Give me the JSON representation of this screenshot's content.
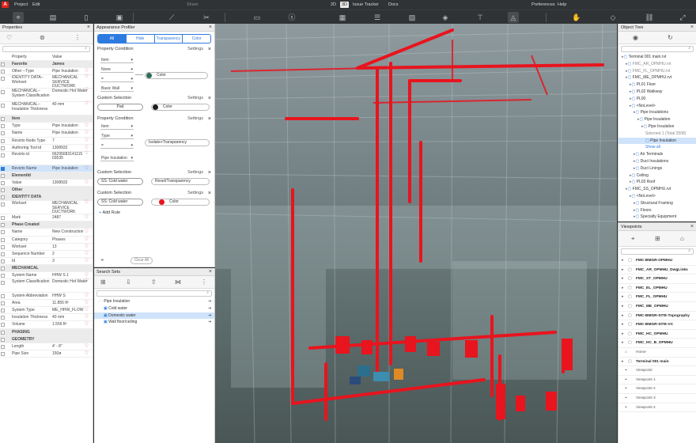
{
  "app": {
    "logo": "A"
  },
  "menu": {
    "project": "Project",
    "edit": "Edit",
    "share": "Share",
    "view2d": "2D",
    "view3d": "3D",
    "issue": "Issue Tracker",
    "docs": "Docs",
    "prefs": "Preferences",
    "help": "Help"
  },
  "props": {
    "title": "Properties",
    "col_prop": "Property",
    "col_val": "Value",
    "rows": [
      {
        "t": "g",
        "n": "Favorite",
        "v": "James"
      },
      {
        "t": "r",
        "n": "Other --Type",
        "v": "Pipe Insulation",
        "h": 1
      },
      {
        "t": "t",
        "n": "IDENTITY DATA--Workset",
        "v": "MECHANICAL SERVICE DUCTWORK",
        "h": 1
      },
      {
        "t": "t",
        "n": "MECHANICAL--System Classification",
        "v": "Domestic Hot Water",
        "h": 1
      },
      {
        "t": "t",
        "n": "MECHANICAL--Insulation Thickness",
        "v": "40 mm",
        "h": 1
      },
      {
        "t": "g",
        "n": "Item",
        "v": ""
      },
      {
        "t": "r",
        "n": "Type",
        "v": "Pipe Insulation",
        "h": 1
      },
      {
        "t": "r",
        "n": "Name",
        "v": "Pipe Insulation",
        "h": 1
      },
      {
        "t": "r",
        "n": "Revizto Node Type",
        "v": "7",
        "h": 1
      },
      {
        "t": "r",
        "n": "Authoring Tool id",
        "v": "1308932",
        "h": 1
      },
      {
        "t": "t",
        "n": "Revizto id",
        "v": "66295683141115 03535",
        "h": 1
      },
      {
        "t": "s",
        "n": "Revizto Name",
        "v": "Pipe Insulation",
        "h": 1
      },
      {
        "t": "g",
        "n": "ElementId",
        "v": ""
      },
      {
        "t": "r",
        "n": "Value",
        "v": "1308932",
        "h": 1
      },
      {
        "t": "g",
        "n": "Other",
        "v": ""
      },
      {
        "t": "g",
        "n": "IDENTITY DATA",
        "v": ""
      },
      {
        "t": "t",
        "n": "Workset",
        "v": "MECHANICAL SERVICE DUCTWORK",
        "h": 1
      },
      {
        "t": "r",
        "n": "Mark",
        "v": "2487",
        "h": 1
      },
      {
        "t": "g",
        "n": "Phase Created",
        "v": ""
      },
      {
        "t": "r",
        "n": "Name",
        "v": "New Construction",
        "h": 1
      },
      {
        "t": "r",
        "n": "Category",
        "v": "Phases",
        "h": 1
      },
      {
        "t": "r",
        "n": "Workset",
        "v": "13",
        "h": 1
      },
      {
        "t": "r",
        "n": "Sequence Number",
        "v": "2",
        "h": 1
      },
      {
        "t": "r",
        "n": "Id",
        "v": "3",
        "h": 1
      },
      {
        "t": "g",
        "n": "MECHANICAL",
        "v": ""
      },
      {
        "t": "r",
        "n": "System Name",
        "v": "HHW S 1",
        "h": 1
      },
      {
        "t": "t",
        "n": "System Classification",
        "v": "Domestic Hot Water",
        "h": 1
      },
      {
        "t": "r",
        "n": "System Abbreviation",
        "v": "HHW S",
        "h": 1
      },
      {
        "t": "r",
        "n": "Area",
        "v": "11.855 ft²",
        "h": 1
      },
      {
        "t": "r",
        "n": "System Type",
        "v": "ME_HHW_FLOW",
        "h": 1
      },
      {
        "t": "r",
        "n": "Insulation Thickness",
        "v": "40 mm",
        "h": 1
      },
      {
        "t": "r",
        "n": "Volume",
        "v": "1.556 ft³",
        "h": 1
      },
      {
        "t": "g",
        "n": "PHASING",
        "v": ""
      },
      {
        "t": "g",
        "n": "GEOMETRY",
        "v": ""
      },
      {
        "t": "r",
        "n": "Length",
        "v": "4' - 8\"",
        "h": 1
      },
      {
        "t": "r",
        "n": "Pipe Size",
        "v": "150ø",
        "h": 1
      }
    ]
  },
  "appearance": {
    "title": "Appearance Profiler",
    "tabs": [
      "All",
      "Hide",
      "Transparency",
      "Color"
    ],
    "settings": "Settings",
    "prop_cond": "Property Condition",
    "custom_sel": "Custom Selection",
    "dd": {
      "item": "Item",
      "none": "None",
      "eq": "=",
      "basic": "Basic Wall",
      "type": "Type",
      "isolate": "Isolate+Transparency",
      "pipeins": "Pipe Insulation",
      "reset": "Reset/Transparency"
    },
    "color": "Color",
    "pad": "Pad",
    "ss_cold": "SS: Cold water",
    "add_rule": "Add Rule",
    "clear_all": "Clear All"
  },
  "search": {
    "title": "Search Sets",
    "items": [
      "Pipe Insulation",
      "Cold water",
      "Domestic water",
      "Wall floor/ceiling"
    ]
  },
  "tree": {
    "title": "Object Tree",
    "rows": [
      {
        "d": 0,
        "t": "Terminal 001 main.rvt"
      },
      {
        "d": 1,
        "t": "FMC_AR_OPMHU.rvt",
        "g": 1
      },
      {
        "d": 1,
        "t": "FMC_FL_OPMHU.rvt",
        "g": 1
      },
      {
        "d": 1,
        "t": "FMC_ME_OPMHU.rvt"
      },
      {
        "d": 2,
        "t": "PL01 Floor"
      },
      {
        "d": 2,
        "t": "PL02 Walkway"
      },
      {
        "d": 2,
        "t": "PL00"
      },
      {
        "d": 2,
        "t": "<NoLevel>"
      },
      {
        "d": 3,
        "t": "Pipe Insulations"
      },
      {
        "d": 4,
        "t": "Pipe Insulation"
      },
      {
        "d": 5,
        "t": "Pipe Insulation"
      },
      {
        "d": 6,
        "t": "Selected 1 (Total 2508)",
        "g": 1
      },
      {
        "d": 6,
        "t": "Pipe Insulation",
        "hl": 1
      },
      {
        "d": 6,
        "t": "Show all",
        "l": 1
      },
      {
        "d": 3,
        "t": "Air Terminals"
      },
      {
        "d": 3,
        "t": "Duct Insulations"
      },
      {
        "d": 3,
        "t": "Duct Linings"
      },
      {
        "d": 2,
        "t": "Ceiling"
      },
      {
        "d": 2,
        "t": "PL03 Roof"
      },
      {
        "d": 1,
        "t": "FMC_SS_OPMHU.rvt"
      },
      {
        "d": 2,
        "t": "<NoLevel>"
      },
      {
        "d": 3,
        "t": "Structural Framing"
      },
      {
        "d": 3,
        "t": "Floors"
      },
      {
        "d": 3,
        "t": "Specialty Equipment"
      }
    ]
  },
  "viewpoints": {
    "title": "Viewpoints",
    "rows": [
      {
        "t": "FMC-BMGR-OPMHU",
        "b": 1
      },
      {
        "t": "FMC_AR_OPMHU_DwgLinks",
        "b": 1
      },
      {
        "t": "FMC_ST_OPMHU",
        "b": 1
      },
      {
        "t": "FMC_EL_OPMHU",
        "b": 1
      },
      {
        "t": "FMC_FL_OPMHU",
        "b": 1
      },
      {
        "t": "FMC_ME_OPMHU",
        "b": 1
      },
      {
        "t": "FMC-BMGR-SITE-Topography",
        "b": 1
      },
      {
        "t": "FMC-BMGR-SITE-VC",
        "b": 1
      },
      {
        "t": "FMC_HC_OPMHU",
        "b": 1
      },
      {
        "t": "FMC_HC_B_OPMHU",
        "b": 1
      },
      {
        "t": "Home",
        "b": 0,
        "v": 0
      },
      {
        "t": "Terminal 001 main",
        "b": 1
      },
      {
        "t": "Viewpoint",
        "v": 1
      },
      {
        "t": "Viewpoint 1",
        "v": 1
      },
      {
        "t": "Viewpoint 2",
        "v": 1
      },
      {
        "t": "Viewpoint 3",
        "v": 1
      },
      {
        "t": "Viewpoint 4",
        "v": 1
      }
    ]
  },
  "colors": {
    "accent": "#2e7be0",
    "pipe": "#e8141e",
    "dark_bar": "#303336"
  }
}
